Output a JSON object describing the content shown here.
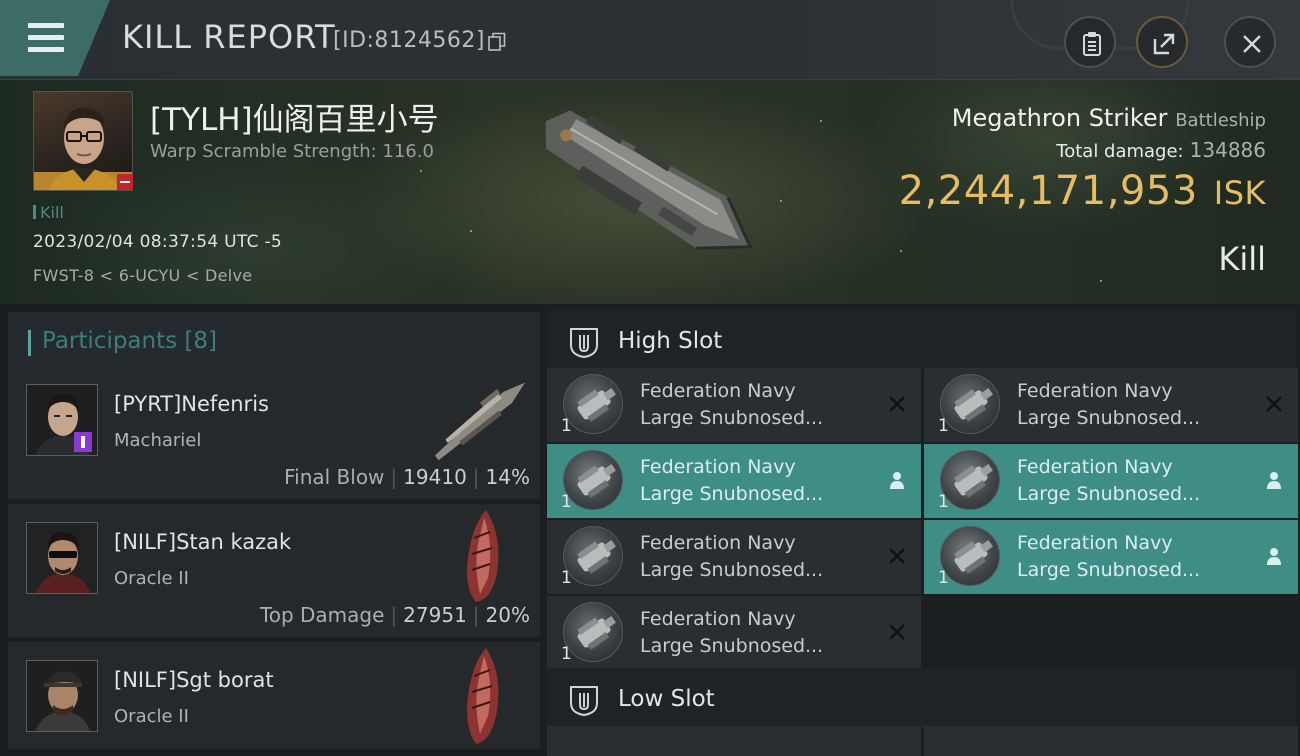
{
  "header": {
    "title": "KILL REPORT",
    "kill_id": "[ID:8124562]"
  },
  "victim": {
    "name": "[TYLH]仙阁百里小号",
    "warp_scramble": "Warp Scramble Strength: 116.0",
    "kill_label": "Kill",
    "datetime": "2023/02/04 08:37:54 UTC -5",
    "location": "FWST-8 < 6-UCYU < Delve",
    "ship_name": "Megathron Striker",
    "ship_class": "Battleship",
    "total_damage_label": "Total damage:",
    "total_damage": "134886",
    "isk_value": "2,244,171,953",
    "isk_unit": "ISK",
    "result": "Kill"
  },
  "participants": {
    "title": "Participants [8]",
    "rows": [
      {
        "name": "[PYRT]Nefenris",
        "ship": "Machariel",
        "label": "Final Blow",
        "damage": "19410",
        "percent": "14%"
      },
      {
        "name": "[NILF]Stan kazak",
        "ship": "Oracle II",
        "label": "Top Damage",
        "damage": "27951",
        "percent": "20%"
      },
      {
        "name": "[NILF]Sgt borat",
        "ship": "Oracle II"
      }
    ]
  },
  "slots": {
    "high": {
      "title": "High Slot",
      "items": [
        {
          "line1": "Federation Navy",
          "line2": "Large Snubnosed...",
          "qty": "1",
          "status": "destroyed"
        },
        {
          "line1": "Federation Navy",
          "line2": "Large Snubnosed...",
          "qty": "1",
          "status": "destroyed"
        },
        {
          "line1": "Federation Navy",
          "line2": "Large Snubnosed...",
          "qty": "1",
          "status": "dropped"
        },
        {
          "line1": "Federation Navy",
          "line2": "Large Snubnosed...",
          "qty": "1",
          "status": "dropped"
        },
        {
          "line1": "Federation Navy",
          "line2": "Large Snubnosed...",
          "qty": "1",
          "status": "destroyed"
        },
        {
          "line1": "Federation Navy",
          "line2": "Large Snubnosed...",
          "qty": "1",
          "status": "dropped"
        },
        {
          "line1": "Federation Navy",
          "line2": "Large Snubnosed...",
          "qty": "1",
          "status": "destroyed"
        }
      ]
    },
    "low": {
      "title": "Low Slot"
    }
  },
  "colors": {
    "accent": "#3e8e86",
    "isk": "#e7bc62",
    "corp_badge": "#c0262b"
  }
}
